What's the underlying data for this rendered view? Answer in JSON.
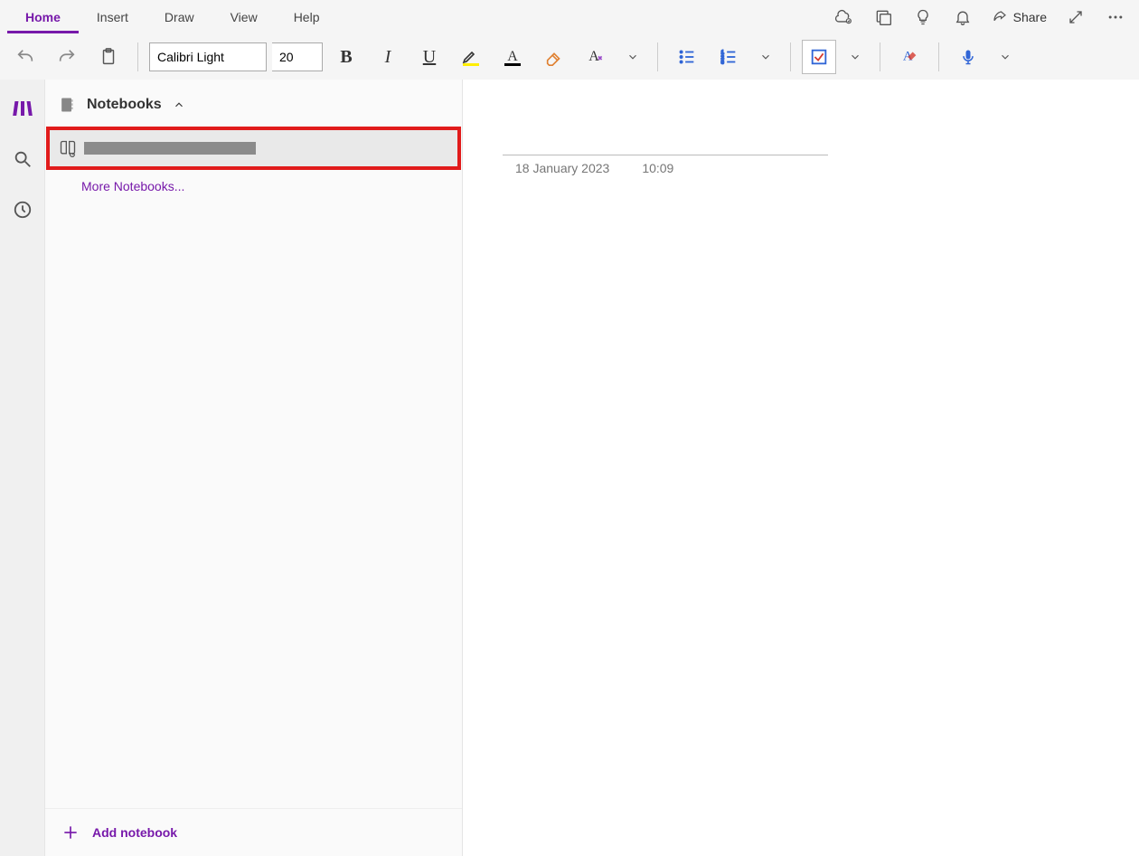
{
  "tabs": {
    "home": "Home",
    "insert": "Insert",
    "draw": "Draw",
    "view": "View",
    "help": "Help"
  },
  "titlebar": {
    "share": "Share"
  },
  "ribbon": {
    "font_name": "Calibri Light",
    "font_size": "20"
  },
  "sidebar": {
    "header": "Notebooks",
    "more": "More Notebooks...",
    "add": "Add notebook"
  },
  "page": {
    "date": "18 January 2023",
    "time": "10:09"
  }
}
